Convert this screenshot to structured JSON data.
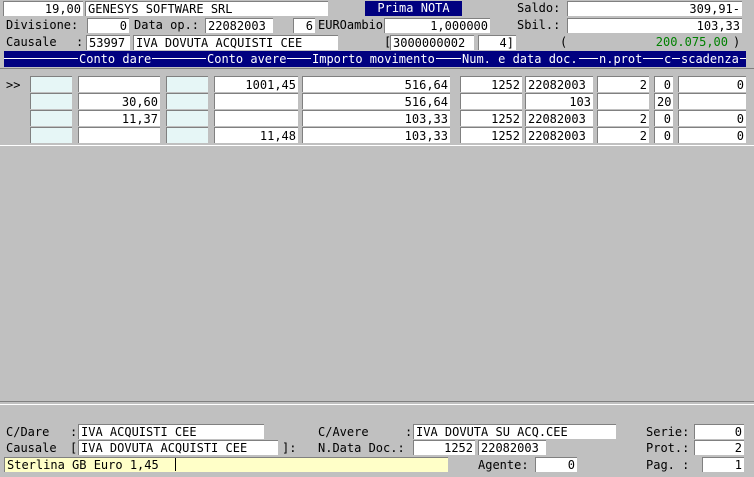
{
  "header": {
    "code": "19,00",
    "company": "GENESYS SOFTWARE SRL",
    "title": "Prima NOTA",
    "saldo_label": "Saldo:",
    "saldo_value": "309,91-",
    "divisione_label": "Divisione:",
    "divisione_value": "0",
    "data_op_label": "Data op.:",
    "data_op_value": "22082003",
    "data_op_extra": "6",
    "eurocambio_label": "EUROambio:",
    "eurocambio_value": "1,000000",
    "sbil_label": "Sbil.:",
    "sbil_value": "103,33",
    "causale_label": "Causale",
    "causale_code": "53997",
    "causale_desc": "IVA DOVUTA ACQUISTI CEE",
    "bracket_open": "[",
    "ref_code": "3000000002",
    "ref_num": "4]",
    "green_open": "(",
    "green_value": "200.075,00",
    "green_close": ")"
  },
  "columns": {
    "conto_dare": "Conto dare",
    "conto_avere": "Conto avere",
    "importo": "Importo movimento",
    "num_data": "Num. e data doc.",
    "nprot": "n.prot",
    "c": "c",
    "scadenza": "scadenza"
  },
  "rows": [
    {
      "marker": ">>",
      "dare_amt": "",
      "avere_amt": "1001,45",
      "importo": "516,64",
      "num": "1252",
      "data": "22082003",
      "prot": "2",
      "c": "0",
      "scad": "0"
    },
    {
      "marker": "",
      "dare_amt": "30,60",
      "avere_amt": "",
      "importo": "516,64",
      "num": "",
      "data": "103",
      "prot": "",
      "c": "20",
      "scad": ""
    },
    {
      "marker": "",
      "dare_amt": "11,37",
      "avere_amt": "",
      "importo": "103,33",
      "num": "1252",
      "data": "22082003",
      "prot": "2",
      "c": "0",
      "scad": "0"
    },
    {
      "marker": "",
      "dare_amt": "",
      "avere_amt": "11,48",
      "importo": "103,33",
      "num": "1252",
      "data": "22082003",
      "prot": "2",
      "c": "0",
      "scad": "0"
    }
  ],
  "footer": {
    "cdare_label": "C/Dare",
    "cdare_value": "IVA ACQUISTI CEE",
    "cavere_label": "C/Avere",
    "cavere_value": "IVA DOVUTA SU ACQ.CEE",
    "serie_label": "Serie:",
    "serie_value": "0",
    "causale_label": "Causale",
    "causale_value": "IVA DOVUTA ACQUISTI CEE",
    "causale_close": "]:",
    "ndata_label": "N.Data Doc.:",
    "ndata_num": "1252",
    "ndata_date": "22082003",
    "prot_label": "Prot.:",
    "prot_value": "2",
    "info_text": "Sterlina GB Euro 1,45",
    "agente_label": "Agente:",
    "agente_value": "0",
    "pag_label": "Pag. :",
    "pag_value": "1"
  }
}
